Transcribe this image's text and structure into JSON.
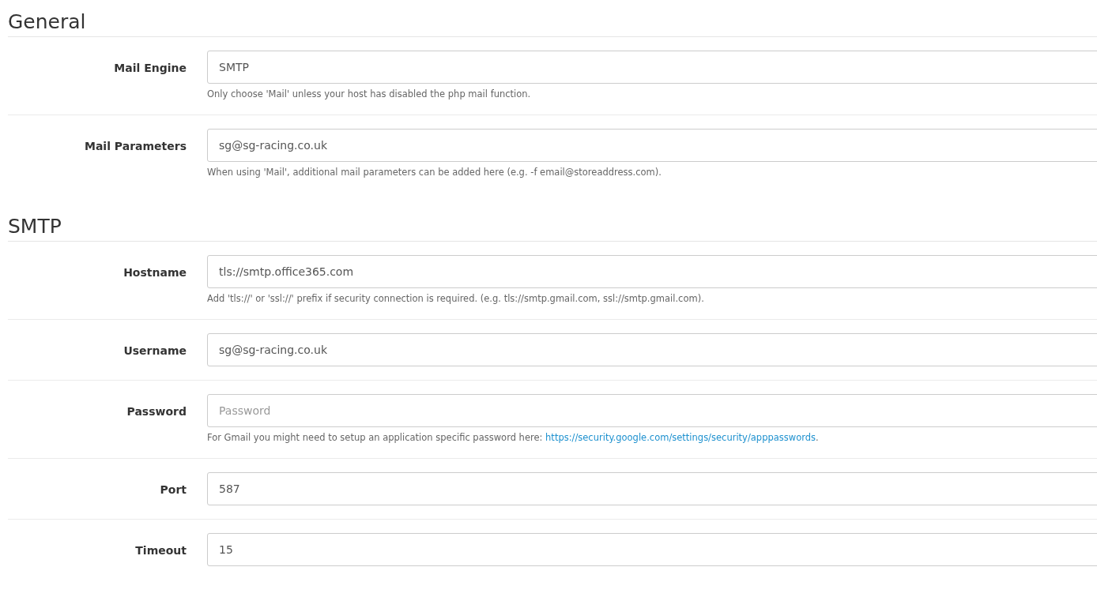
{
  "sections": [
    {
      "title": "General",
      "fields": [
        {
          "label": "Mail Engine",
          "value": "SMTP",
          "help": "Only choose 'Mail' unless your host has disabled the php mail function."
        },
        {
          "label": "Mail Parameters",
          "value": "sg@sg-racing.co.uk",
          "help": "When using 'Mail', additional mail parameters can be added here (e.g. -f email@storeaddress.com)."
        }
      ]
    },
    {
      "title": "SMTP",
      "fields": [
        {
          "label": "Hostname",
          "value": "tls://smtp.office365.com",
          "help": "Add 'tls://' or 'ssl://' prefix if security connection is required. (e.g. tls://smtp.gmail.com, ssl://smtp.gmail.com)."
        },
        {
          "label": "Username",
          "value": "sg@sg-racing.co.uk"
        },
        {
          "label": "Password",
          "placeholder": "Password",
          "help": "For Gmail you might need to setup an application specific password here: ",
          "help_link": "https://security.google.com/settings/security/apppasswords",
          "help_end": "."
        },
        {
          "label": "Port",
          "value": "587"
        },
        {
          "label": "Timeout",
          "value": "15"
        }
      ]
    }
  ]
}
